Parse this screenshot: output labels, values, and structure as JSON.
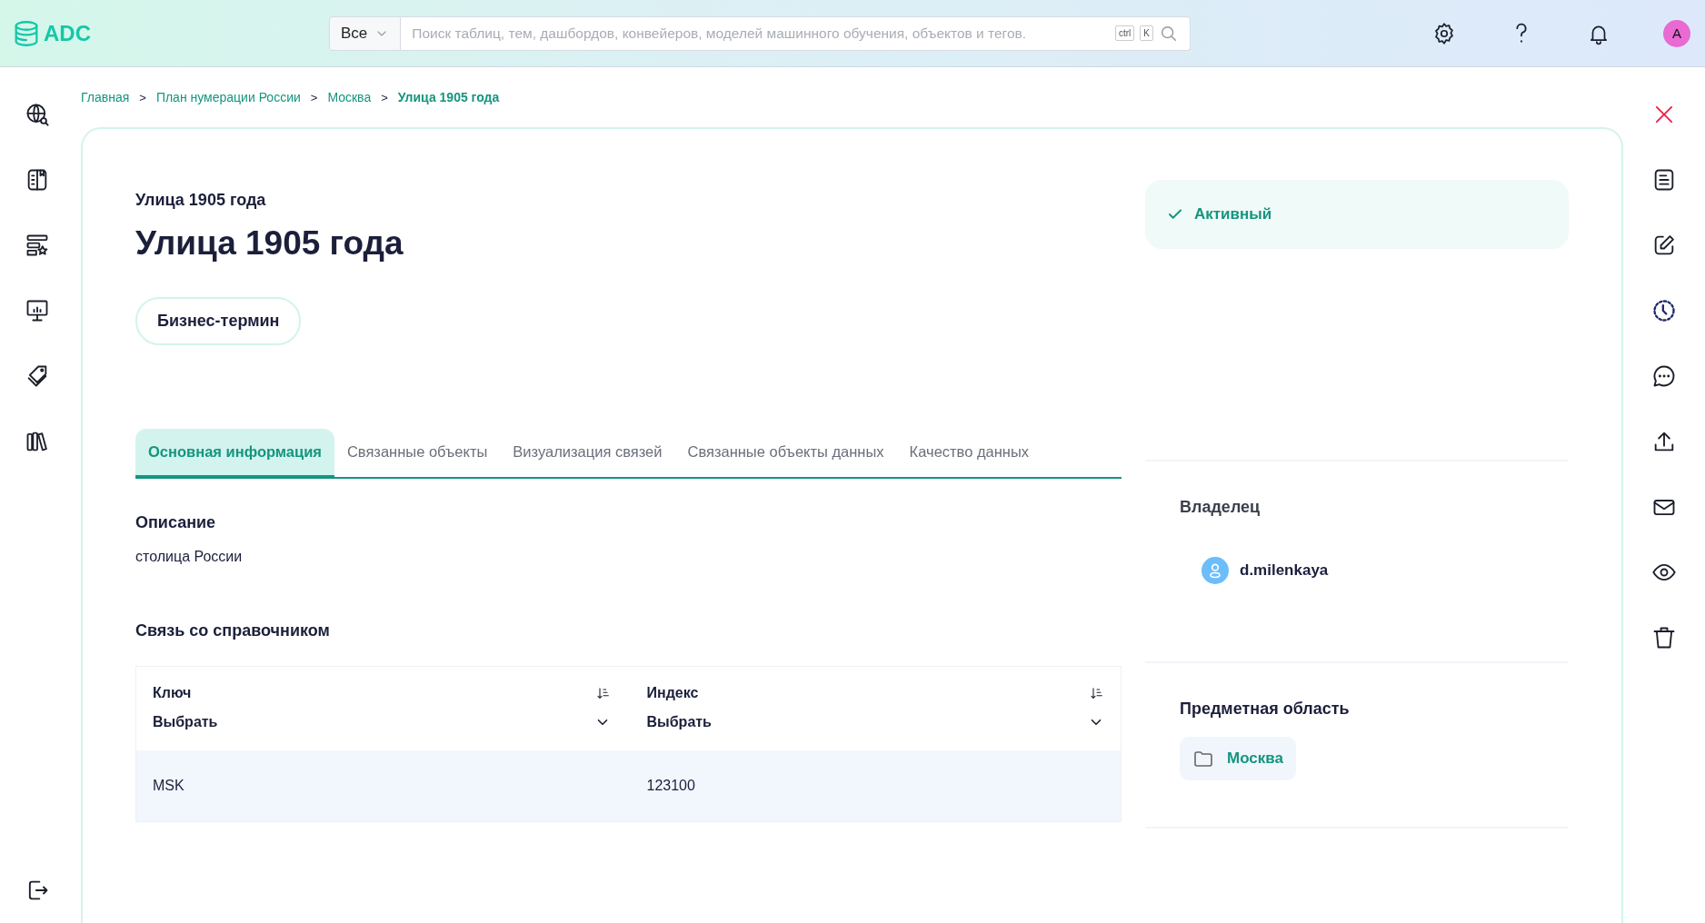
{
  "header": {
    "logo": "ADC",
    "search_scope": "Все",
    "search": {
      "placeholder": "Поиск таблиц, тем, дашбордов, конвейеров, моделей машинного обучения, объектов и тегов."
    },
    "shortcut_keys": [
      "ctrl",
      "K"
    ],
    "avatar": "A"
  },
  "breadcrumbs": {
    "items": [
      {
        "label": "Главная",
        "current": false
      },
      {
        "label": "План нумерации России",
        "current": false
      },
      {
        "label": "Москва",
        "current": false
      },
      {
        "label": "Улица 1905 года",
        "current": true
      }
    ],
    "separators": [
      ">",
      ">",
      ">"
    ]
  },
  "entity": {
    "subtitle": "Улица 1905 года",
    "title": "Улица 1905 года",
    "type_chip": "Бизнес-термин"
  },
  "tabs": [
    {
      "label": "Основная информация",
      "selected": true
    },
    {
      "label": "Связанные объекты",
      "selected": false
    },
    {
      "label": "Визуализация связей",
      "selected": false
    },
    {
      "label": "Связанные объекты данных",
      "selected": false
    },
    {
      "label": "Качество данных",
      "selected": false
    }
  ],
  "description": {
    "heading": "Описание",
    "text": "столица России"
  },
  "reference": {
    "heading": "Связь со справочником",
    "columns": [
      {
        "name": "Ключ",
        "filter": "Выбрать"
      },
      {
        "name": "Индекс",
        "filter": "Выбрать"
      }
    ],
    "rows": [
      [
        "MSK",
        "123100"
      ]
    ]
  },
  "status": {
    "label": "Активный"
  },
  "owner": {
    "heading": "Владелец",
    "name": "d.milenkaya"
  },
  "domain": {
    "heading": "Предметная область",
    "name": "Москва"
  }
}
